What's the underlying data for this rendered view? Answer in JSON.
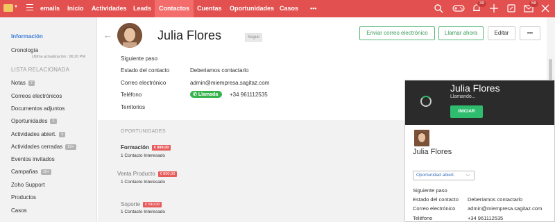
{
  "topnav": {
    "items": [
      {
        "label": "emails"
      },
      {
        "label": "Inicio"
      },
      {
        "label": "Actividades"
      },
      {
        "label": "Leads"
      },
      {
        "label": "Contactos"
      },
      {
        "label": "Cuentas"
      },
      {
        "label": "Oportunidades"
      },
      {
        "label": "Casos"
      },
      {
        "label": "•••"
      }
    ],
    "active": "Contactos",
    "notifications_count": "39",
    "mail_count": "58",
    "icons": [
      "search-icon",
      "gamepad-icon",
      "bell-icon",
      "plus-icon",
      "external-icon",
      "mail-icon",
      "tools-icon"
    ]
  },
  "sidebar": {
    "info_label": "Información",
    "timeline_label": "Cronología",
    "last_update": "Ultima actualización : 06:20 PM",
    "related_heading": "LISTA RELACIONADA",
    "items": [
      {
        "label": "Notas",
        "count": "7"
      },
      {
        "label": "Correos electrónicos",
        "count": ""
      },
      {
        "label": "Documentos adjuntos",
        "count": ""
      },
      {
        "label": "Oportunidades",
        "count": "1"
      },
      {
        "label": "Actividades abiert.",
        "count": "5"
      },
      {
        "label": "Actividades cerradas",
        "count": "10+"
      },
      {
        "label": "Eventos invitados",
        "count": ""
      },
      {
        "label": "Campañas",
        "count": "10+"
      },
      {
        "label": "Zoho Support",
        "count": ""
      },
      {
        "label": "Productos",
        "count": ""
      },
      {
        "label": "Casos",
        "count": ""
      }
    ]
  },
  "header": {
    "name": "Julia Flores",
    "follow_label": "Seguir",
    "btn_email": "Enviar correo electrónico",
    "btn_call": "Llamar ahora",
    "btn_edit": "Editar",
    "btn_more": "•••"
  },
  "details": {
    "next_step_label": "Siguiente paso",
    "status_label": "Estado del contacto",
    "status_value": "Deberiamos contactarlo",
    "email_label": "Correo electrónico",
    "email_value": "admin@miempresa.sagitaz.com",
    "phone_label": "Teléfono",
    "call_pill": "Llamada",
    "phone_value": "+34 961112535",
    "territories_label": "Territorios"
  },
  "opportunities": {
    "heading": "OPORTUNIDADES",
    "items": [
      {
        "title": "Formación",
        "price": "€ 899,00",
        "sub": "1 Contacto Interesado"
      },
      {
        "title": "Venta Producto",
        "price": "€ 800,00",
        "sub": "1 Contacto Interesado"
      },
      {
        "title": "Soporte",
        "price": "€ 540,00",
        "sub": "1 Contacto Interesado"
      }
    ]
  },
  "callpanel": {
    "name": "Julia Flores",
    "status": "Llamando...",
    "start_label": "INICIAR",
    "name2": "Julia Flores",
    "select_value": "Oportunidad abiert.",
    "next_step_label": "Siguiente paso",
    "status_label": "Estado del contacto",
    "status_value": "Deberiamos contactarlo",
    "email_label": "Correo electrónico",
    "email_value": "admin@miempresa.sagitaz.com",
    "phone_label": "Teléfono",
    "phone_value": "+34 961112535"
  },
  "colors": {
    "topbar": "#e2504f",
    "active_tab": "#f26d6b",
    "accent_green": "#2ebd6e",
    "link_blue": "#3b7ad6"
  }
}
